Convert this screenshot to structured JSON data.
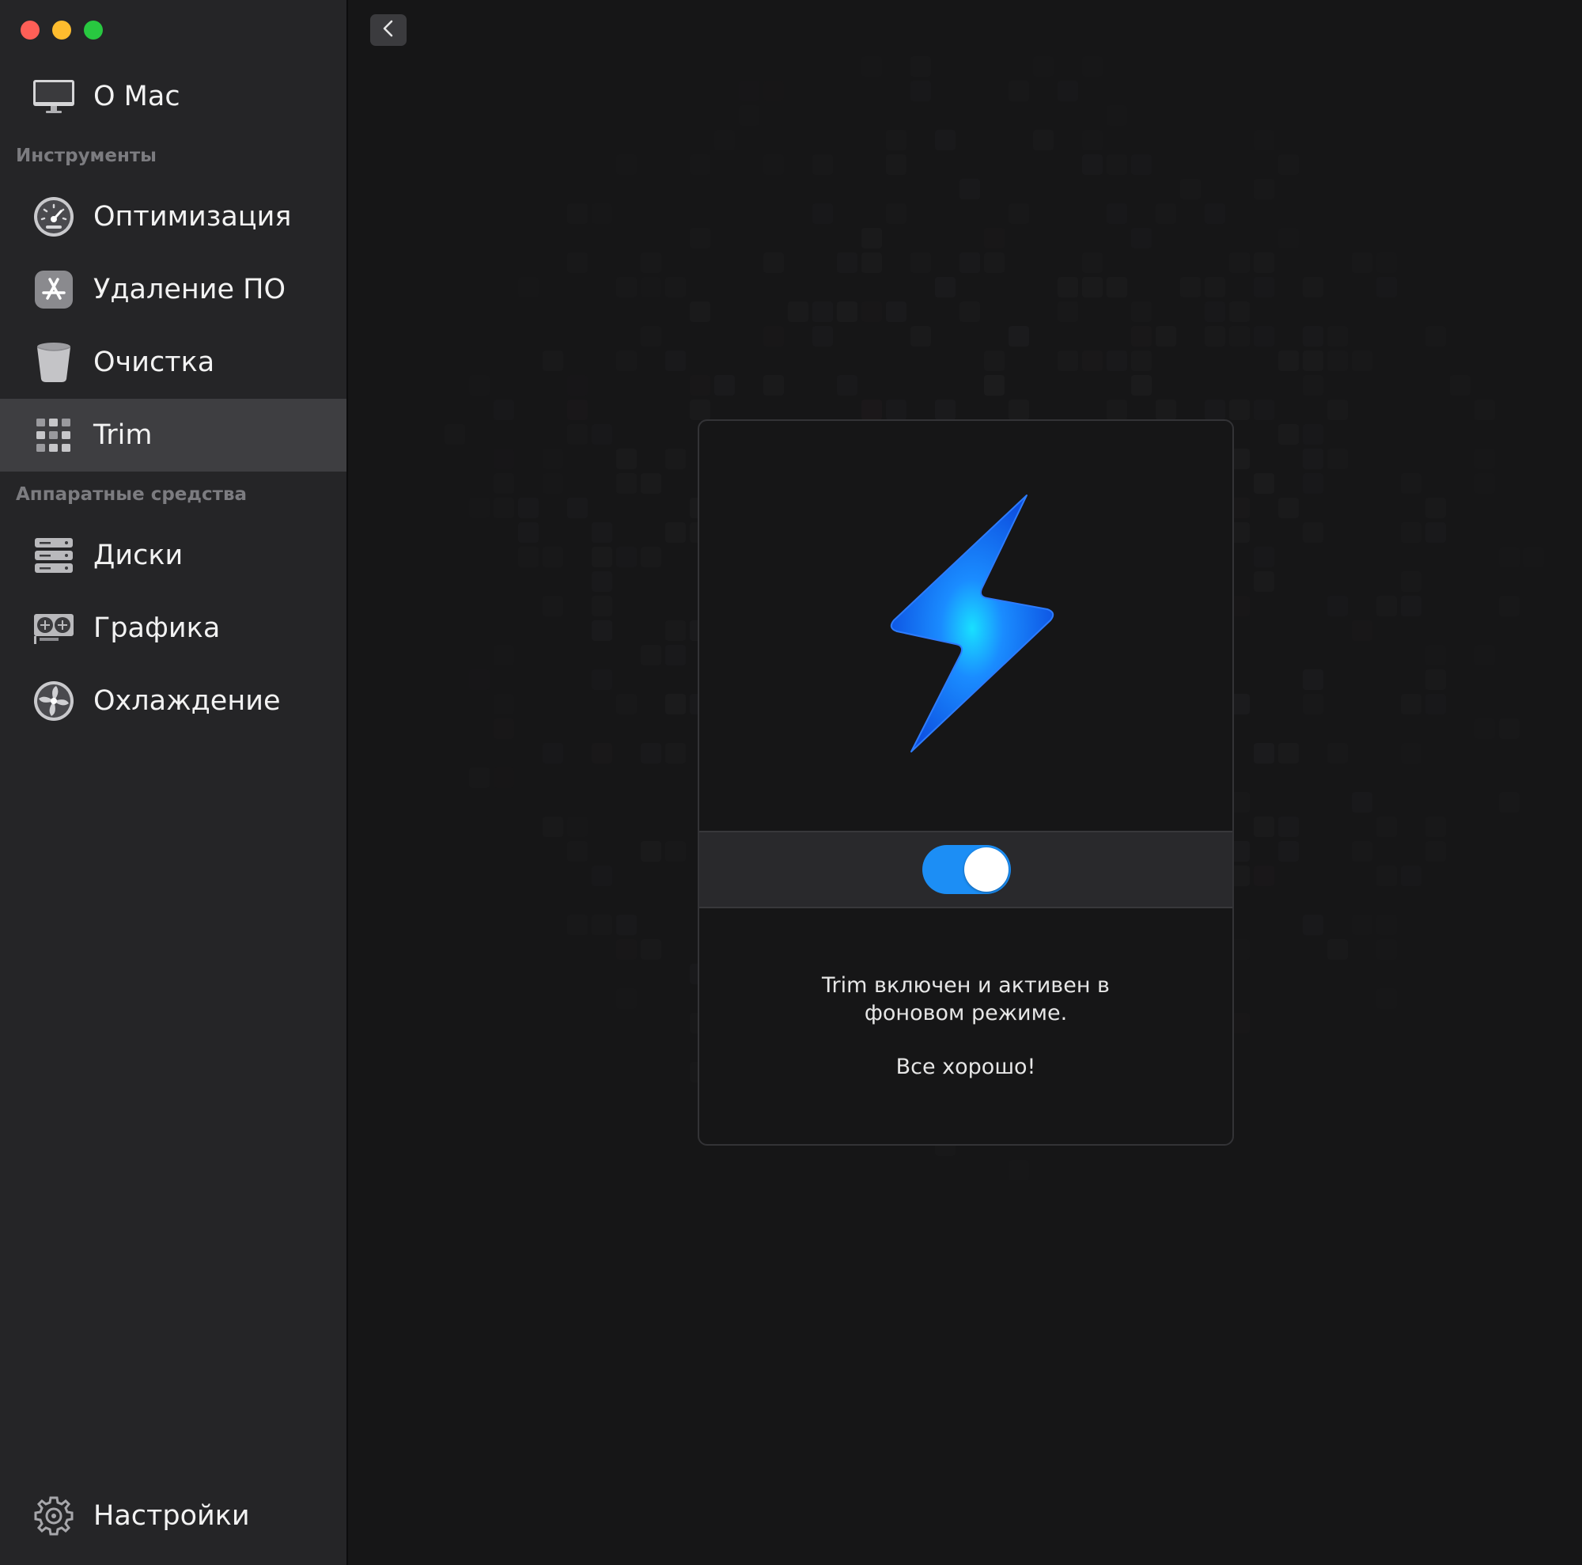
{
  "window": {
    "controls": {
      "close": "close",
      "minimize": "minimize",
      "zoom": "zoom"
    }
  },
  "sidebar": {
    "about": {
      "label": "О Mac",
      "icon": "imac-icon"
    },
    "sections": [
      {
        "header": "Инструменты",
        "items": [
          {
            "label": "Оптимизация",
            "icon": "gauge-icon"
          },
          {
            "label": "Удаление ПО",
            "icon": "app-store-icon"
          },
          {
            "label": "Очистка",
            "icon": "trash-bin-icon"
          },
          {
            "label": "Trim",
            "icon": "grid-icon",
            "active": true
          }
        ]
      },
      {
        "header": "Аппаратные средства",
        "items": [
          {
            "label": "Диски",
            "icon": "disks-icon"
          },
          {
            "label": "Графика",
            "icon": "graphics-card-icon"
          },
          {
            "label": "Охлаждение",
            "icon": "fan-icon"
          }
        ]
      }
    ],
    "settings": {
      "label": "Настройки",
      "icon": "gear-icon"
    }
  },
  "main": {
    "back_button_icon": "chevron-left-icon",
    "card": {
      "icon": "lightning-bolt-icon",
      "toggle_on": true,
      "status_text": "Trim включен и активен в фоновом режиме.",
      "status_line1": "Trim включен и активен в",
      "status_line2": "фоновом режиме.",
      "ok_text": "Все хорошо!"
    }
  },
  "colors": {
    "accent": "#1c8ef5",
    "sidebar_bg": "#252527",
    "main_bg": "#161617",
    "active_item_bg": "#3e3e41"
  }
}
